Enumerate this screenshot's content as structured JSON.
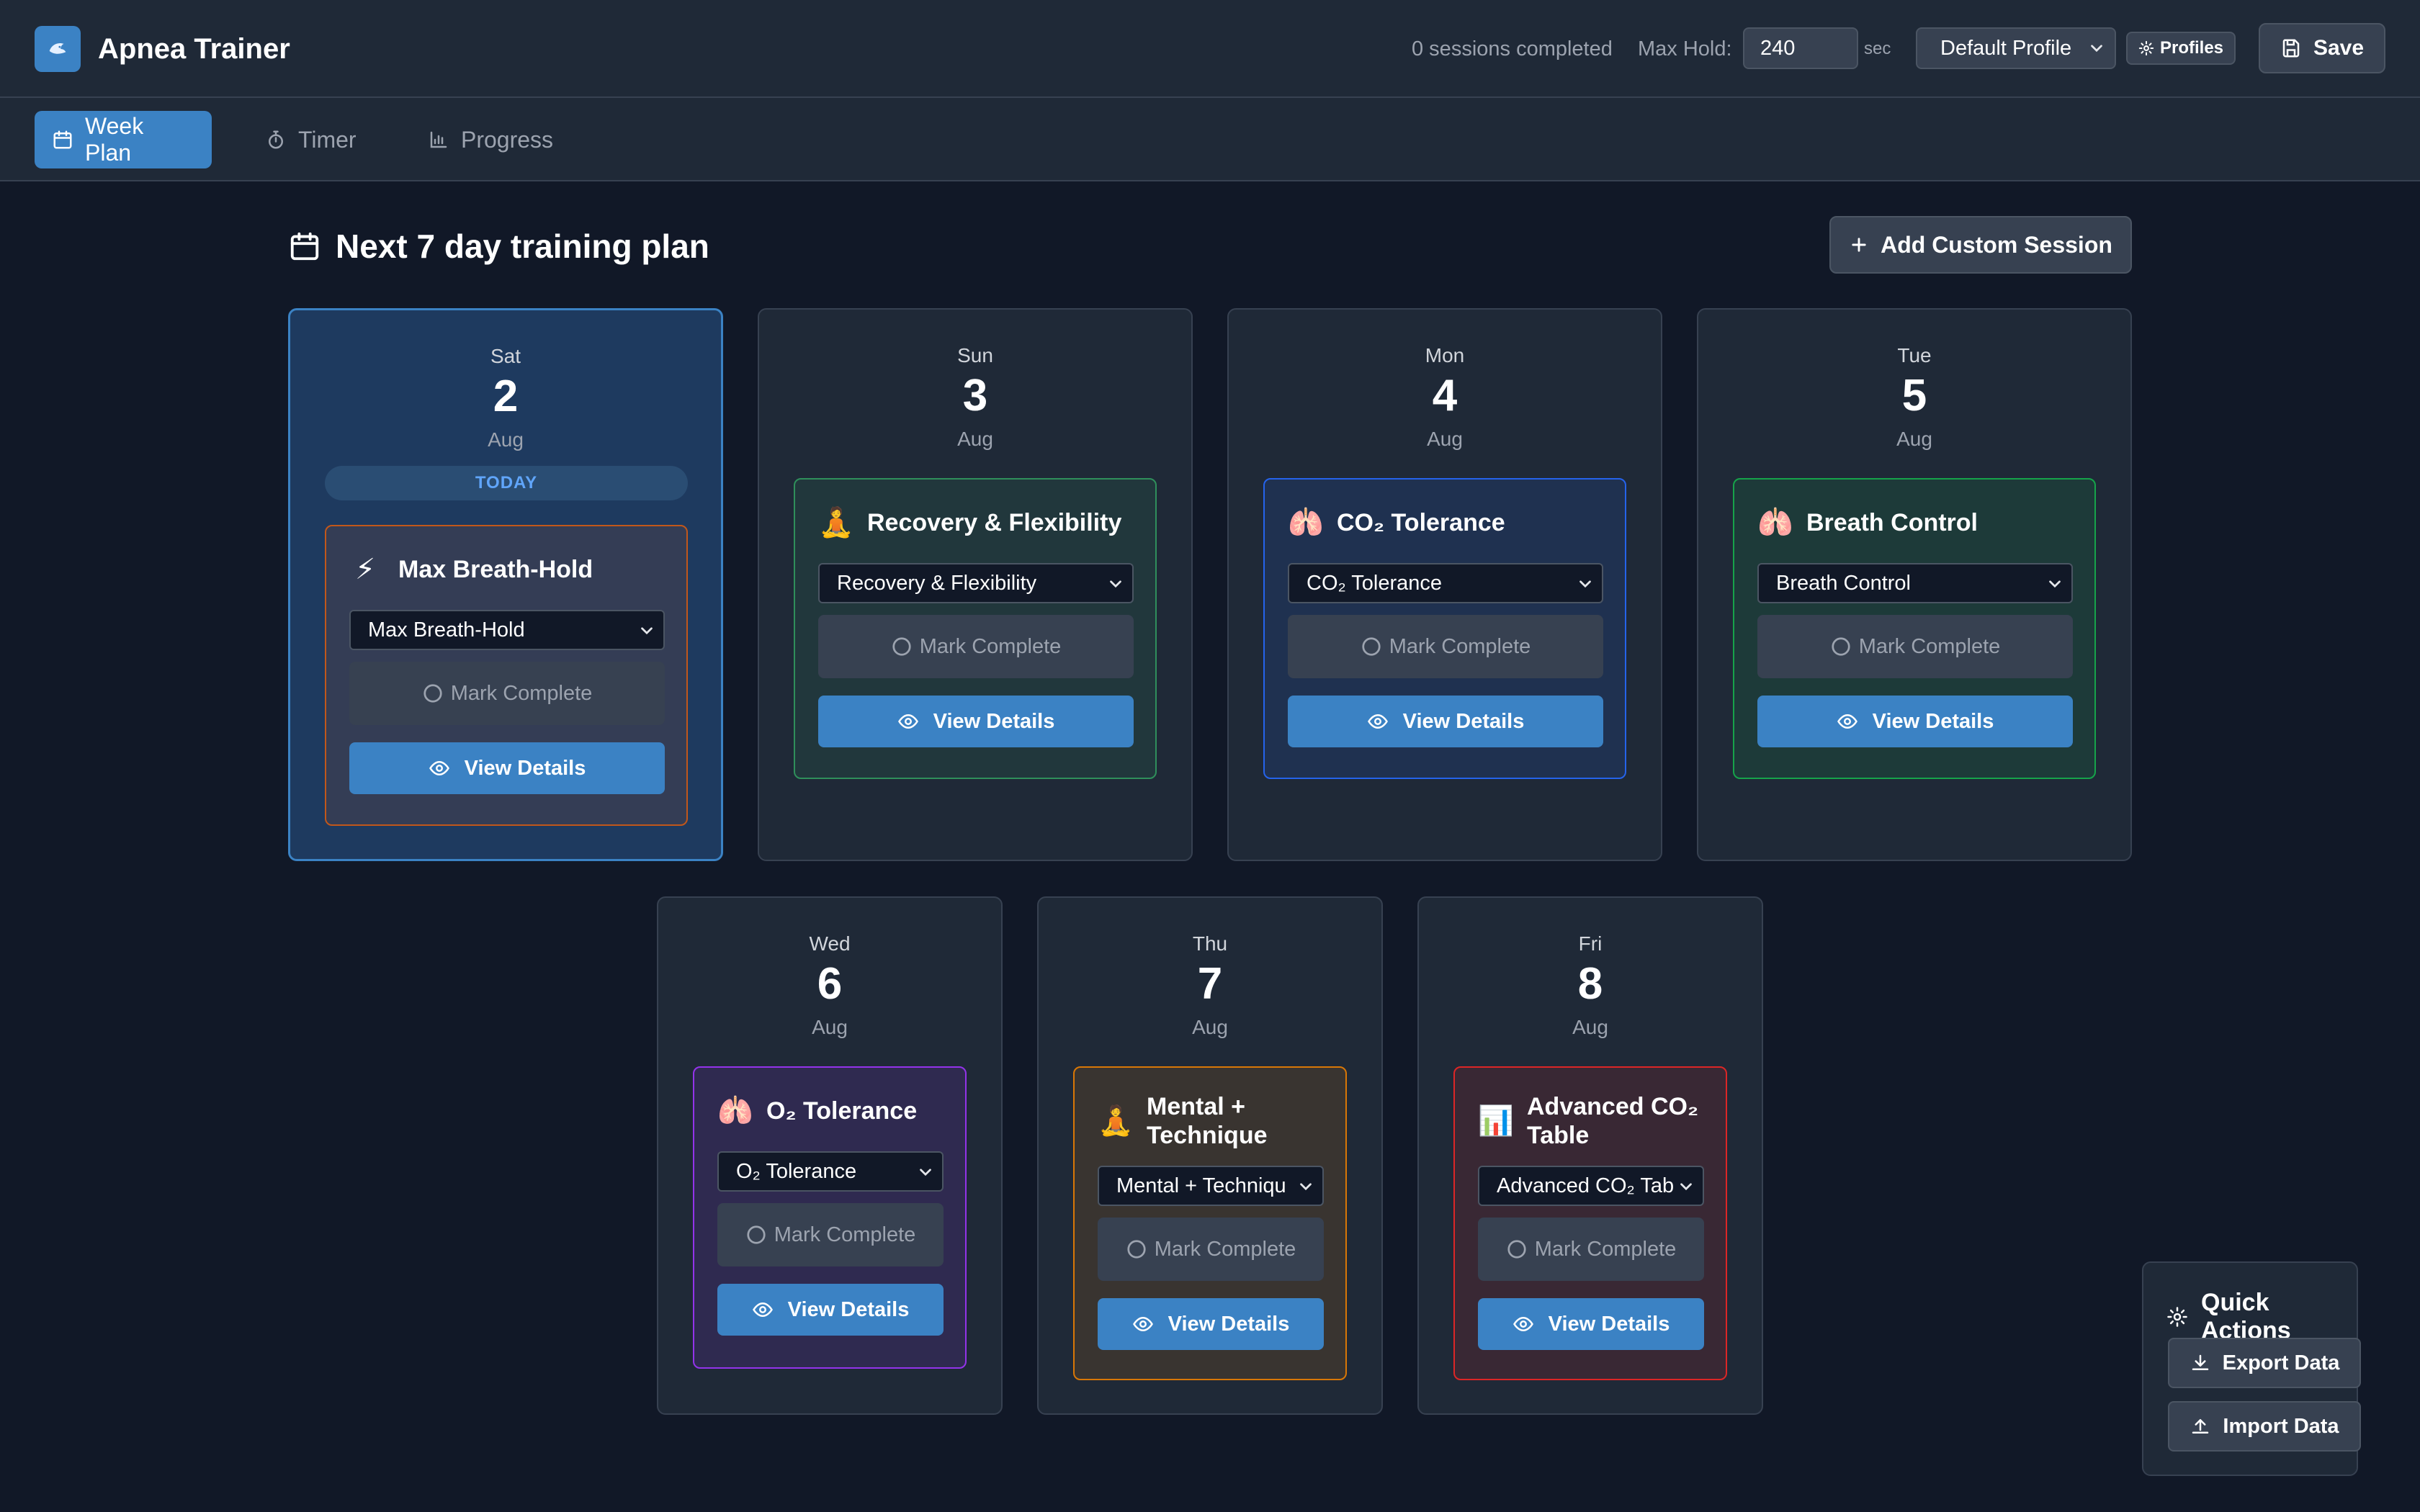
{
  "header": {
    "app_title": "Apnea Trainer",
    "sessions_completed": "0 sessions completed",
    "max_hold_label": "Max Hold:",
    "max_hold_value": "240",
    "max_hold_unit": "sec",
    "profile_select": "Default Profile",
    "profiles_label": "Profiles",
    "save_label": "Save"
  },
  "tabs": [
    {
      "label": "Week Plan",
      "active": true,
      "icon": "calendar-icon"
    },
    {
      "label": "Timer",
      "active": false,
      "icon": "stopwatch-icon"
    },
    {
      "label": "Progress",
      "active": false,
      "icon": "bar-chart-icon"
    }
  ],
  "main": {
    "title": "Next 7 day training plan",
    "add_session_label": "Add Custom Session"
  },
  "days": [
    {
      "weekday": "Sat",
      "day": "2",
      "month": "Aug",
      "today": true,
      "today_label": "TODAY",
      "session": {
        "emoji": "⚡",
        "title": "Max Breath-Hold",
        "select": "Max Breath-Hold",
        "accent": "#c2571a"
      }
    },
    {
      "weekday": "Sun",
      "day": "3",
      "month": "Aug",
      "today": false,
      "session": {
        "emoji": "🧘",
        "title": "Recovery & Flexibility",
        "select": "Recovery & Flexibility",
        "accent": "#2f8f5b"
      }
    },
    {
      "weekday": "Mon",
      "day": "4",
      "month": "Aug",
      "today": false,
      "session": {
        "emoji": "🫁",
        "title": "CO₂ Tolerance",
        "select": "CO₂ Tolerance",
        "accent": "#2563eb"
      }
    },
    {
      "weekday": "Tue",
      "day": "5",
      "month": "Aug",
      "today": false,
      "session": {
        "emoji": "🫁",
        "title": "Breath Control",
        "select": "Breath Control",
        "accent": "#16a34a"
      }
    },
    {
      "weekday": "Wed",
      "day": "6",
      "month": "Aug",
      "today": false,
      "session": {
        "emoji": "🫁",
        "title": "O₂ Tolerance",
        "select": "O₂ Tolerance",
        "accent": "#9333ea"
      }
    },
    {
      "weekday": "Thu",
      "day": "7",
      "month": "Aug",
      "today": false,
      "session": {
        "emoji": "🧘",
        "title": "Mental + Technique",
        "select": "Mental + Techniqu",
        "accent": "#d97706"
      }
    },
    {
      "weekday": "Fri",
      "day": "8",
      "month": "Aug",
      "today": false,
      "session": {
        "emoji": "📊",
        "title": "Advanced CO₂ Table",
        "select": "Advanced CO₂ Tab",
        "accent": "#dc2626"
      }
    }
  ],
  "buttons": {
    "mark_complete": "Mark Complete",
    "view_details": "View Details"
  },
  "quick_actions": {
    "title": "Quick Actions",
    "export_label": "Export Data",
    "import_label": "Import Data"
  },
  "colors": {
    "background": "#111827",
    "panel": "#1f2937",
    "primary": "#3b82c4"
  }
}
